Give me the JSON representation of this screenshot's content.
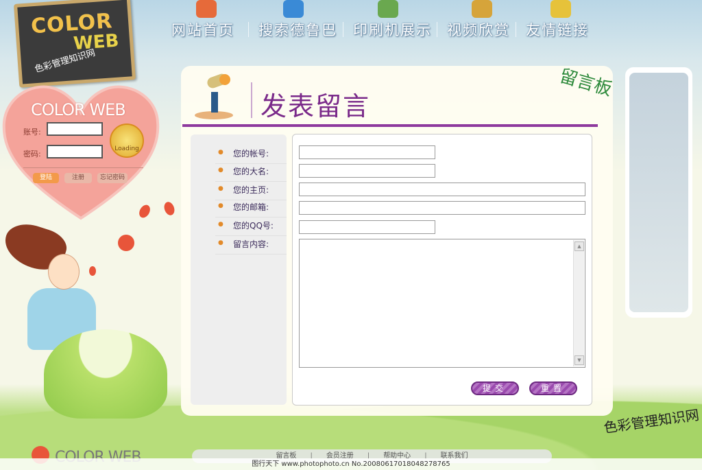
{
  "nav": {
    "items": [
      {
        "label": "网站首页",
        "icon": "home-icon",
        "color": "#e66a3a"
      },
      {
        "label": "搜索德鲁巴",
        "icon": "magnifier-icon",
        "color": "#3a8ad6"
      },
      {
        "label": "印刷机展示",
        "icon": "printer-icon",
        "color": "#6aa84f"
      },
      {
        "label": "视频欣赏",
        "icon": "monitor-icon",
        "color": "#d6a43a"
      },
      {
        "label": "友情链接",
        "icon": "children-icon",
        "color": "#e6c23a"
      }
    ]
  },
  "logo": {
    "word1": "COLOR",
    "word2": "WEB",
    "subtitle": "色彩管理知识网"
  },
  "login": {
    "title": "COLOR WEB",
    "account_label": "账号:",
    "password_label": "密码:",
    "loading_label": "Loading",
    "buttons": [
      "登陆",
      "注册",
      "忘记密码"
    ]
  },
  "page": {
    "title": "发表留言",
    "board_name": "留言板"
  },
  "form": {
    "fields": [
      {
        "label": "您的帐号:",
        "value": ""
      },
      {
        "label": "您的大名:",
        "value": ""
      },
      {
        "label": "您的主页:",
        "value": ""
      },
      {
        "label": "您的邮箱:",
        "value": ""
      },
      {
        "label": "您的QQ号:",
        "value": ""
      },
      {
        "label": "留言内容:",
        "value": ""
      }
    ],
    "submit_label": "提交",
    "reset_label": "重置"
  },
  "footer": {
    "links": [
      "留言板",
      "会员注册",
      "帮助中心",
      "联系我们"
    ],
    "logo_text": "COLOR WEB",
    "tagline": "色彩管理知识网",
    "watermark": "图行天下 www.photophoto.cn No.20080617018048278765"
  },
  "colors": {
    "accent_purple": "#8e3a9e",
    "heart_pink": "#f4a39a",
    "grass_green": "#9ccf5f"
  }
}
